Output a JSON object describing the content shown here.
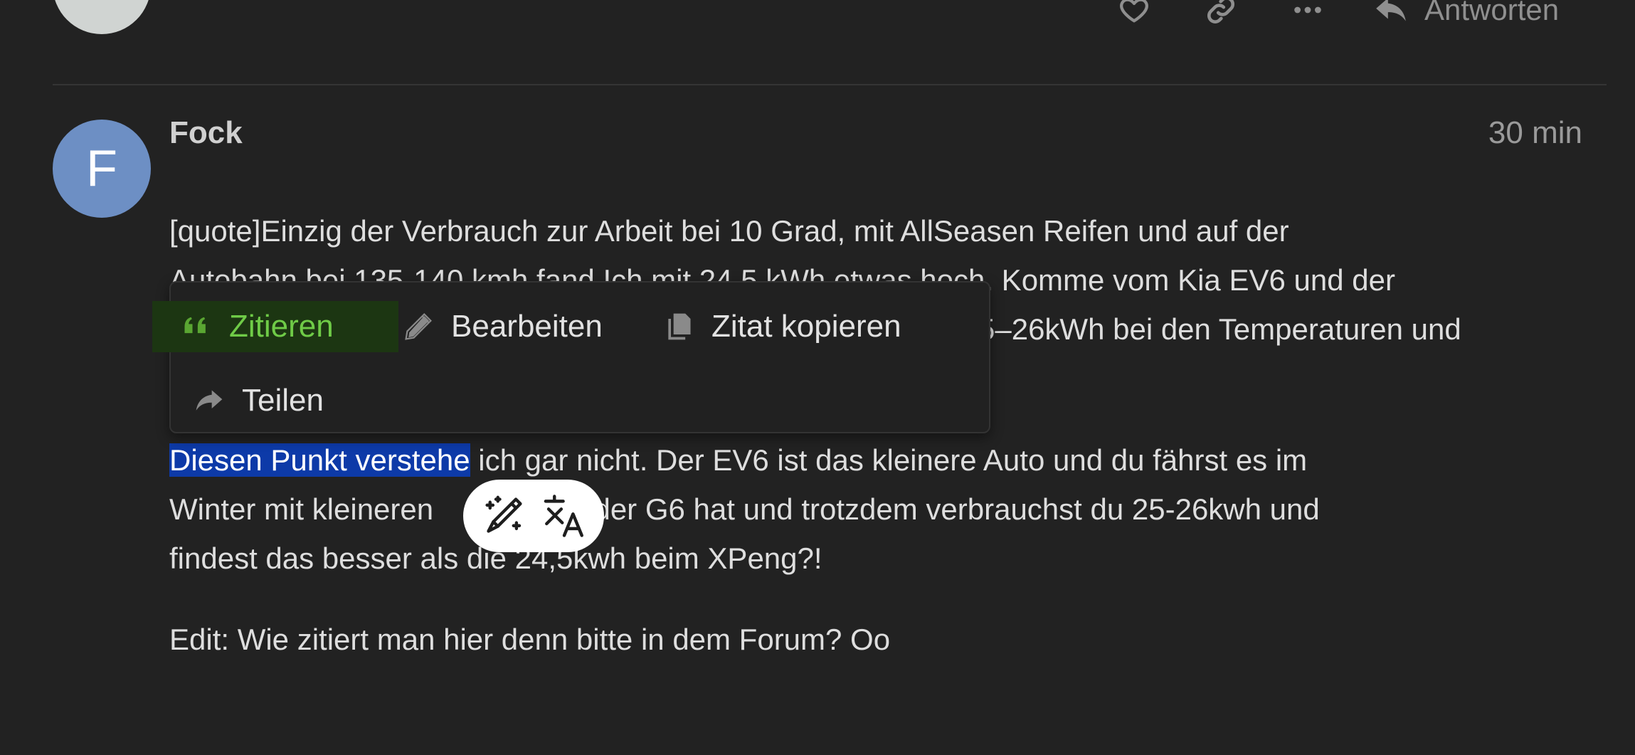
{
  "previous_post": {
    "avatar_letter": "",
    "actions": [
      {
        "name": "like-button",
        "icon": "heart-icon"
      },
      {
        "name": "copy-link-button",
        "icon": "link-icon"
      },
      {
        "name": "more-button",
        "icon": "ellipsis-icon"
      }
    ],
    "reply_label": "Antworten"
  },
  "post": {
    "avatar_letter": "F",
    "avatar_color": "#6d8fc4",
    "username": "Fock",
    "time": "30 min",
    "paragraph1": {
      "line1": "[quote]Einzig der Verbrauch zur Arbeit bei 10 Grad, mit AllSeasen Reifen und auf der",
      "line2_visible": "Autobahn bei 135-140 kmh fand Ich mit 24,5 kWh etwas hoch. Komme vom Kia EV6 und der",
      "line3_fragment": "5–26kWh bei den Temperaturen und"
    },
    "paragraph2": {
      "selected": "Diesen Punkt verstehe",
      "line1_rest": " ich gar nicht. Der EV6 ist das kleinere Auto und du fährst es im",
      "line2_start": "Winter mit kleineren",
      "line2_end": "als der G6 hat und trotzdem verbrauchst du 25-26kwh und",
      "line3": "findest das besser als die 24,5kwh beim XPeng?!"
    },
    "paragraph3": "Edit: Wie zitiert man hier denn bitte in dem Forum? Oo"
  },
  "quote_menu": {
    "quote_label": "Zitieren",
    "edit_label": "Bearbeiten",
    "copy_quote_label": "Zitat kopieren",
    "share_label": "Teilen",
    "accent_color": "#6fcb47"
  },
  "float_toolbar": {
    "buttons": [
      {
        "name": "ai-assist-button",
        "icon": "magic-wand-icon"
      },
      {
        "name": "translate-button",
        "icon": "translate-icon"
      }
    ]
  },
  "colors": {
    "background": "#222222",
    "selection": "#0d3aa8"
  }
}
